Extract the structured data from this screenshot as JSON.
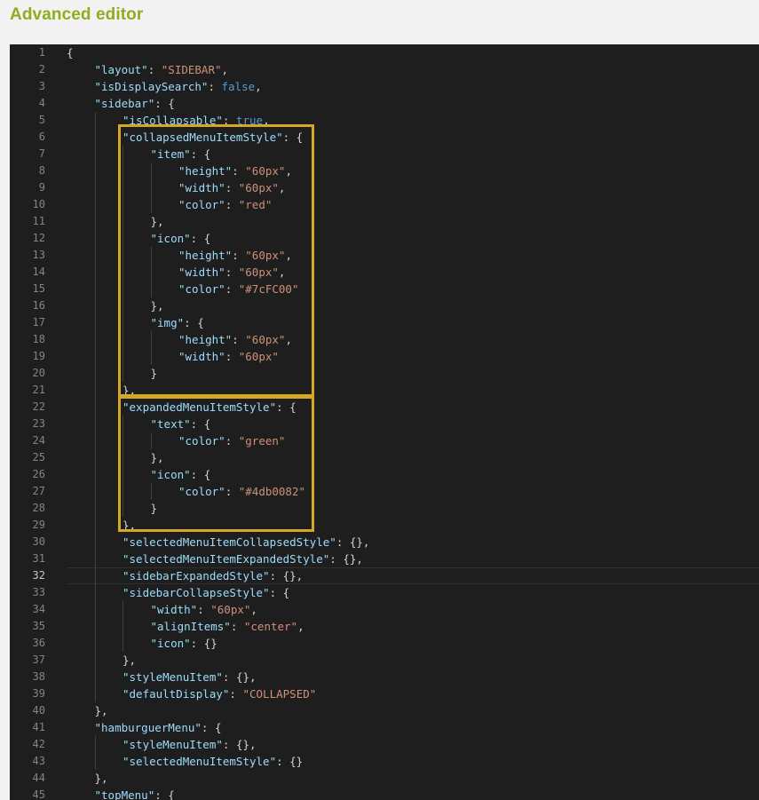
{
  "page": {
    "title": "Advanced editor"
  },
  "editor": {
    "active_line": 32,
    "lines": [
      {
        "n": "1",
        "i": 0,
        "t": [
          [
            "p",
            "{"
          ]
        ]
      },
      {
        "n": "2",
        "i": 1,
        "t": [
          [
            "k",
            "\"layout\""
          ],
          [
            "p",
            ": "
          ],
          [
            "s",
            "\"SIDEBAR\""
          ],
          [
            "p",
            ","
          ]
        ]
      },
      {
        "n": "3",
        "i": 1,
        "t": [
          [
            "k",
            "\"isDisplaySearch\""
          ],
          [
            "p",
            ": "
          ],
          [
            "b",
            "false"
          ],
          [
            "p",
            ","
          ]
        ]
      },
      {
        "n": "4",
        "i": 1,
        "t": [
          [
            "k",
            "\"sidebar\""
          ],
          [
            "p",
            ": {"
          ]
        ]
      },
      {
        "n": "5",
        "i": 2,
        "t": [
          [
            "k",
            "\"isCollapsable\""
          ],
          [
            "p",
            ": "
          ],
          [
            "b",
            "true"
          ],
          [
            "p",
            ","
          ]
        ]
      },
      {
        "n": "6",
        "i": 2,
        "t": [
          [
            "k",
            "\"collapsedMenuItemStyle\""
          ],
          [
            "p",
            ": {"
          ]
        ]
      },
      {
        "n": "7",
        "i": 3,
        "t": [
          [
            "k",
            "\"item\""
          ],
          [
            "p",
            ": {"
          ]
        ]
      },
      {
        "n": "8",
        "i": 4,
        "t": [
          [
            "k",
            "\"height\""
          ],
          [
            "p",
            ": "
          ],
          [
            "s",
            "\"60px\""
          ],
          [
            "p",
            ","
          ]
        ]
      },
      {
        "n": "9",
        "i": 4,
        "t": [
          [
            "k",
            "\"width\""
          ],
          [
            "p",
            ": "
          ],
          [
            "s",
            "\"60px\""
          ],
          [
            "p",
            ","
          ]
        ]
      },
      {
        "n": "10",
        "i": 4,
        "t": [
          [
            "k",
            "\"color\""
          ],
          [
            "p",
            ": "
          ],
          [
            "s",
            "\"red\""
          ]
        ]
      },
      {
        "n": "11",
        "i": 3,
        "t": [
          [
            "p",
            "},"
          ]
        ]
      },
      {
        "n": "12",
        "i": 3,
        "t": [
          [
            "k",
            "\"icon\""
          ],
          [
            "p",
            ": {"
          ]
        ]
      },
      {
        "n": "13",
        "i": 4,
        "t": [
          [
            "k",
            "\"height\""
          ],
          [
            "p",
            ": "
          ],
          [
            "s",
            "\"60px\""
          ],
          [
            "p",
            ","
          ]
        ]
      },
      {
        "n": "14",
        "i": 4,
        "t": [
          [
            "k",
            "\"width\""
          ],
          [
            "p",
            ": "
          ],
          [
            "s",
            "\"60px\""
          ],
          [
            "p",
            ","
          ]
        ]
      },
      {
        "n": "15",
        "i": 4,
        "t": [
          [
            "k",
            "\"color\""
          ],
          [
            "p",
            ": "
          ],
          [
            "s",
            "\"#7cFC00\""
          ]
        ]
      },
      {
        "n": "16",
        "i": 3,
        "t": [
          [
            "p",
            "},"
          ]
        ]
      },
      {
        "n": "17",
        "i": 3,
        "t": [
          [
            "k",
            "\"img\""
          ],
          [
            "p",
            ": {"
          ]
        ]
      },
      {
        "n": "18",
        "i": 4,
        "t": [
          [
            "k",
            "\"height\""
          ],
          [
            "p",
            ": "
          ],
          [
            "s",
            "\"60px\""
          ],
          [
            "p",
            ","
          ]
        ]
      },
      {
        "n": "19",
        "i": 4,
        "t": [
          [
            "k",
            "\"width\""
          ],
          [
            "p",
            ": "
          ],
          [
            "s",
            "\"60px\""
          ]
        ]
      },
      {
        "n": "20",
        "i": 3,
        "t": [
          [
            "p",
            "}"
          ]
        ]
      },
      {
        "n": "21",
        "i": 2,
        "t": [
          [
            "p",
            "},"
          ]
        ]
      },
      {
        "n": "22",
        "i": 2,
        "t": [
          [
            "k",
            "\"expandedMenuItemStyle\""
          ],
          [
            "p",
            ": {"
          ]
        ]
      },
      {
        "n": "23",
        "i": 3,
        "t": [
          [
            "k",
            "\"text\""
          ],
          [
            "p",
            ": {"
          ]
        ]
      },
      {
        "n": "24",
        "i": 4,
        "t": [
          [
            "k",
            "\"color\""
          ],
          [
            "p",
            ": "
          ],
          [
            "s",
            "\"green\""
          ]
        ]
      },
      {
        "n": "25",
        "i": 3,
        "t": [
          [
            "p",
            "},"
          ]
        ]
      },
      {
        "n": "26",
        "i": 3,
        "t": [
          [
            "k",
            "\"icon\""
          ],
          [
            "p",
            ": {"
          ]
        ]
      },
      {
        "n": "27",
        "i": 4,
        "t": [
          [
            "k",
            "\"color\""
          ],
          [
            "p",
            ": "
          ],
          [
            "s",
            "\"#4db0082\""
          ]
        ]
      },
      {
        "n": "28",
        "i": 3,
        "t": [
          [
            "p",
            "}"
          ]
        ]
      },
      {
        "n": "29",
        "i": 2,
        "t": [
          [
            "p",
            "},"
          ]
        ]
      },
      {
        "n": "30",
        "i": 2,
        "t": [
          [
            "k",
            "\"selectedMenuItemCollapsedStyle\""
          ],
          [
            "p",
            ": {},"
          ]
        ]
      },
      {
        "n": "31",
        "i": 2,
        "t": [
          [
            "k",
            "\"selectedMenuItemExpandedStyle\""
          ],
          [
            "p",
            ": {},"
          ]
        ]
      },
      {
        "n": "32",
        "i": 2,
        "t": [
          [
            "k",
            "\"sidebarExpandedStyle\""
          ],
          [
            "p",
            ": {},"
          ]
        ]
      },
      {
        "n": "33",
        "i": 2,
        "t": [
          [
            "k",
            "\"sidebarCollapseStyle\""
          ],
          [
            "p",
            ": {"
          ]
        ]
      },
      {
        "n": "34",
        "i": 3,
        "t": [
          [
            "k",
            "\"width\""
          ],
          [
            "p",
            ": "
          ],
          [
            "s",
            "\"60px\""
          ],
          [
            "p",
            ","
          ]
        ]
      },
      {
        "n": "35",
        "i": 3,
        "t": [
          [
            "k",
            "\"alignItems\""
          ],
          [
            "p",
            ": "
          ],
          [
            "s",
            "\"center\""
          ],
          [
            "p",
            ","
          ]
        ]
      },
      {
        "n": "36",
        "i": 3,
        "t": [
          [
            "k",
            "\"icon\""
          ],
          [
            "p",
            ": {}"
          ]
        ]
      },
      {
        "n": "37",
        "i": 2,
        "t": [
          [
            "p",
            "},"
          ]
        ]
      },
      {
        "n": "38",
        "i": 2,
        "t": [
          [
            "k",
            "\"styleMenuItem\""
          ],
          [
            "p",
            ": {},"
          ]
        ]
      },
      {
        "n": "39",
        "i": 2,
        "t": [
          [
            "k",
            "\"defaultDisplay\""
          ],
          [
            "p",
            ": "
          ],
          [
            "s",
            "\"COLLAPSED\""
          ]
        ]
      },
      {
        "n": "40",
        "i": 1,
        "t": [
          [
            "p",
            "},"
          ]
        ]
      },
      {
        "n": "41",
        "i": 1,
        "t": [
          [
            "k",
            "\"hamburguerMenu\""
          ],
          [
            "p",
            ": {"
          ]
        ]
      },
      {
        "n": "42",
        "i": 2,
        "t": [
          [
            "k",
            "\"styleMenuItem\""
          ],
          [
            "p",
            ": {},"
          ]
        ]
      },
      {
        "n": "43",
        "i": 2,
        "t": [
          [
            "k",
            "\"selectedMenuItemStyle\""
          ],
          [
            "p",
            ": {}"
          ]
        ]
      },
      {
        "n": "44",
        "i": 1,
        "t": [
          [
            "p",
            "},"
          ]
        ]
      },
      {
        "n": "45",
        "i": 1,
        "t": [
          [
            "k",
            "\"topMenu\""
          ],
          [
            "p",
            ": {"
          ]
        ]
      }
    ]
  },
  "colors": {
    "heading": "#8dae1e",
    "highlight_box": "#d4a827",
    "editor_bg": "#1e1e1e",
    "key": "#9cdcfe",
    "string": "#ce9178",
    "keyword": "#569cd6",
    "punctuation": "#d4d4d4"
  }
}
